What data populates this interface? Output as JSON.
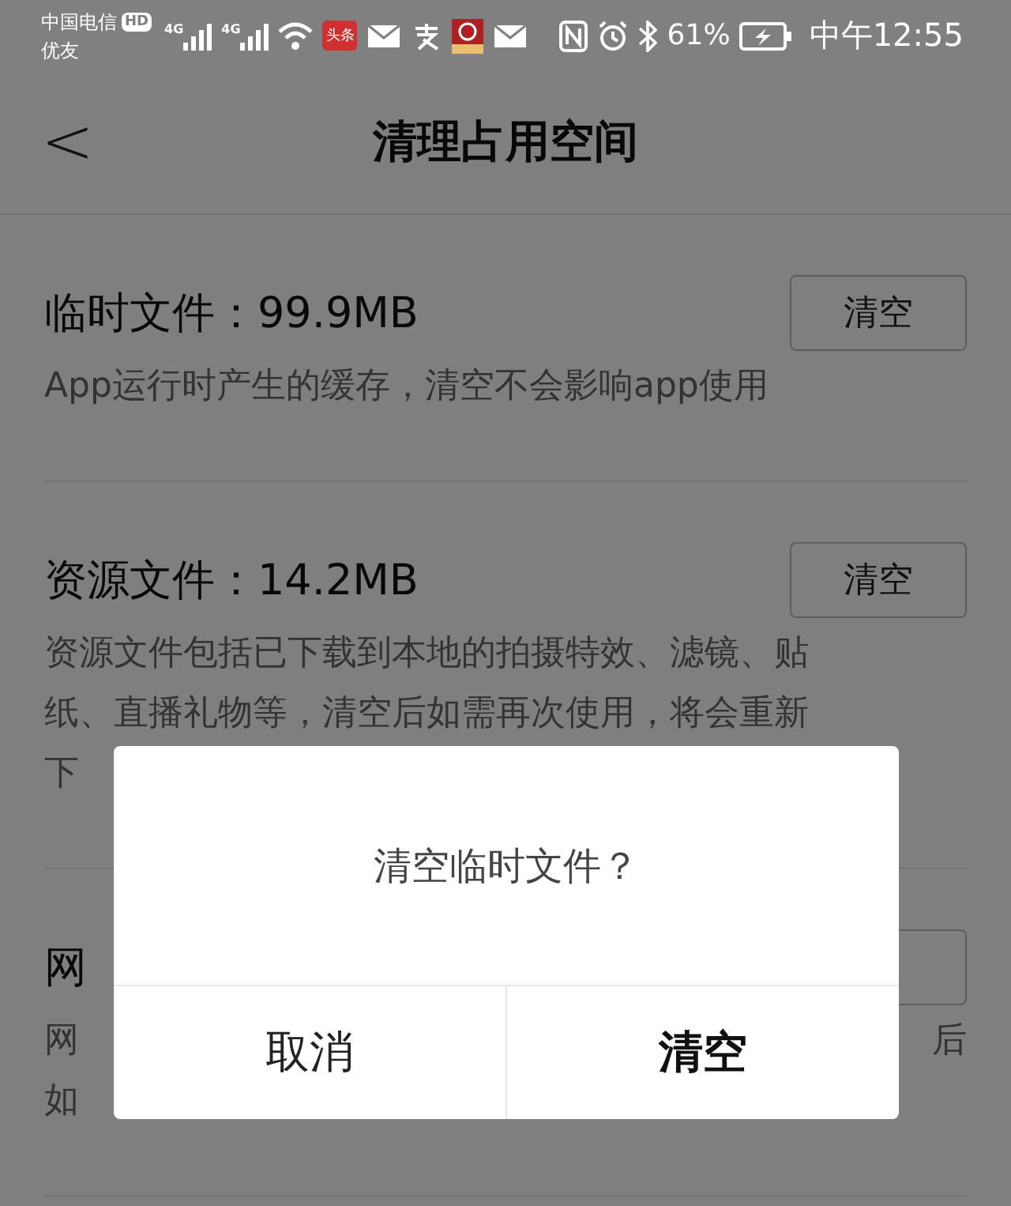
{
  "status_bar": {
    "carrier": "中国电信",
    "hd": "HD",
    "carrier_2": "优友",
    "network_1": "4G",
    "network_2": "4G",
    "app_badge": "头条",
    "battery": "61%",
    "time": "中午12:55"
  },
  "header": {
    "back": "<",
    "title": "清理占用空间"
  },
  "sections": [
    {
      "title": "临时文件：99.9MB",
      "button": {
        "label": "清空"
      },
      "lines": [
        {
          "left": "App运行时产生的缓存，清空不会影响app使用"
        }
      ]
    },
    {
      "title": "资源文件：14.2MB",
      "button": {
        "label": "清空"
      },
      "lines": [
        {
          "left": "资源文件包括已下载到本地的拍摄特效、滤镜、贴"
        },
        {
          "left": "纸、直播礼物等，清空后如需再次使用，将会重新"
        },
        {
          "left": "下"
        }
      ]
    },
    {
      "title": "网",
      "lines": [
        {
          "left": "网",
          "right": "后"
        },
        {
          "left": "如"
        }
      ]
    }
  ],
  "dialog": {
    "message": "清空临时文件？",
    "buttons": [
      {
        "label": "取消",
        "primary": false
      },
      {
        "label": "清空",
        "primary": true
      }
    ]
  }
}
